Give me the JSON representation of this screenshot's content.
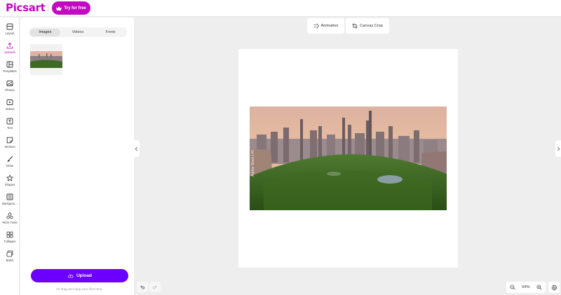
{
  "brand": {
    "name": "Picsart",
    "color": "#c209c1"
  },
  "header": {
    "try_label": "Try for free",
    "try_icon": "crown-icon"
  },
  "rail": {
    "items": [
      {
        "label": "Layout",
        "icon": "layout-icon"
      },
      {
        "label": "Uploads",
        "icon": "upload-icon",
        "active": true
      },
      {
        "label": "Templates",
        "icon": "templates-icon"
      },
      {
        "label": "Photos",
        "icon": "photo-icon"
      },
      {
        "label": "Videos",
        "icon": "video-icon"
      },
      {
        "label": "Text",
        "icon": "text-icon"
      },
      {
        "label": "Stickers",
        "icon": "sticker-icon"
      },
      {
        "label": "Draw",
        "icon": "brush-icon"
      },
      {
        "label": "Shapes",
        "icon": "star-icon"
      },
      {
        "label": "Backgrou...",
        "icon": "background-icon"
      },
      {
        "label": "More Tools",
        "icon": "tools-icon"
      },
      {
        "label": "Collages",
        "icon": "collage-icon"
      },
      {
        "label": "Batch",
        "icon": "batch-icon"
      }
    ]
  },
  "panel": {
    "tabs": [
      {
        "label": "Images",
        "active": true
      },
      {
        "label": "Videos"
      },
      {
        "label": "Fonts"
      }
    ],
    "upload_label": "Upload",
    "drag_text": "Or drag and drop your files here."
  },
  "toolbar": {
    "animation_label": "Animation",
    "crop_label": "Canvas Crop"
  },
  "canvas": {
    "watermark": "Adobe Stock | #5"
  },
  "footer": {
    "zoom": "64%"
  },
  "colors": {
    "accent": "#c209c1",
    "upload": "#6c00ff"
  }
}
